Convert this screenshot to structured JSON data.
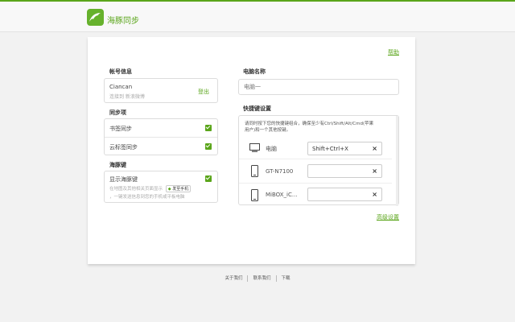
{
  "header": {
    "brand": "海豚同步"
  },
  "help": "帮助",
  "account": {
    "title": "帐号信息",
    "username": "Ciancan",
    "linked": "连接到 新浪微博",
    "logout": "登出"
  },
  "sync": {
    "title": "同步项",
    "items": [
      {
        "label": "书签同步",
        "checked": true
      },
      {
        "label": "云标签同步",
        "checked": true
      }
    ]
  },
  "dolphin_key": {
    "title": "海豚键",
    "label": "显示海豚键",
    "checked": true,
    "desc_line1": "在地图及其他相关页面显示",
    "desc_line2": "，一键发送信息到您的手机或平板电脑",
    "badge": "发至手机"
  },
  "computer_name": {
    "title": "电脑名称",
    "placeholder": "电脑一"
  },
  "shortcut": {
    "title": "快捷键设置",
    "desc_line1": "请同时按下您的快捷键组合，确保至少有Ctrl/Shift/Alt/Cmd(苹果",
    "desc_line2": "用户)和一个其他按键。",
    "devices": [
      {
        "icon": "monitor-icon",
        "name": "电脑",
        "value": "Shift+Ctrl+X"
      },
      {
        "icon": "phone-icon",
        "name": "GT-N7100",
        "value": ""
      },
      {
        "icon": "phone-icon",
        "name": "MiBOX_iC...",
        "value": ""
      }
    ],
    "clear": "×"
  },
  "advanced": "高级设置",
  "footer": {
    "about": "关于我们",
    "contact": "联系我们",
    "download": "下载"
  },
  "colors": {
    "accent": "#5aa51a"
  }
}
